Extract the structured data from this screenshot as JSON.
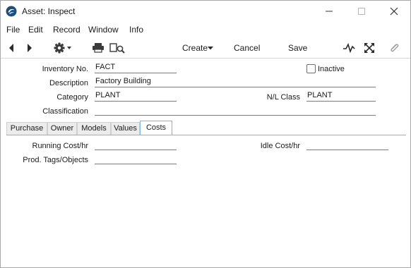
{
  "window": {
    "title": "Asset: Inspect",
    "controls": {
      "minimize": "minimize",
      "maximize": "maximize",
      "close": "close"
    }
  },
  "menu": [
    "File",
    "Edit",
    "Record",
    "Window",
    "Info"
  ],
  "toolbar": {
    "create_label": "Create",
    "cancel_label": "Cancel",
    "save_label": "Save"
  },
  "form": {
    "inventory_no": {
      "label": "Inventory No.",
      "value": "FACT"
    },
    "inactive": {
      "label": "Inactive",
      "checked": false
    },
    "description": {
      "label": "Description",
      "value": "Factory Building"
    },
    "category": {
      "label": "Category",
      "value": "PLANT"
    },
    "nl_class": {
      "label": "N/L Class",
      "value": "PLANT"
    },
    "classification": {
      "label": "Classification",
      "value": ""
    }
  },
  "tabs": [
    {
      "label": "Purchase",
      "active": false
    },
    {
      "label": "Owner",
      "active": false
    },
    {
      "label": "Models",
      "active": false
    },
    {
      "label": "Values",
      "active": false
    },
    {
      "label": "Costs",
      "active": true
    }
  ],
  "costs": {
    "running_cost": {
      "label": "Running Cost/hr",
      "value": ""
    },
    "idle_cost": {
      "label": "Idle Cost/hr",
      "value": ""
    },
    "prod_tags": {
      "label": "Prod. Tags/Objects",
      "value": ""
    }
  },
  "colors": {
    "tab_accent": "#7fb3e0",
    "field_line": "#7a7a7a"
  }
}
